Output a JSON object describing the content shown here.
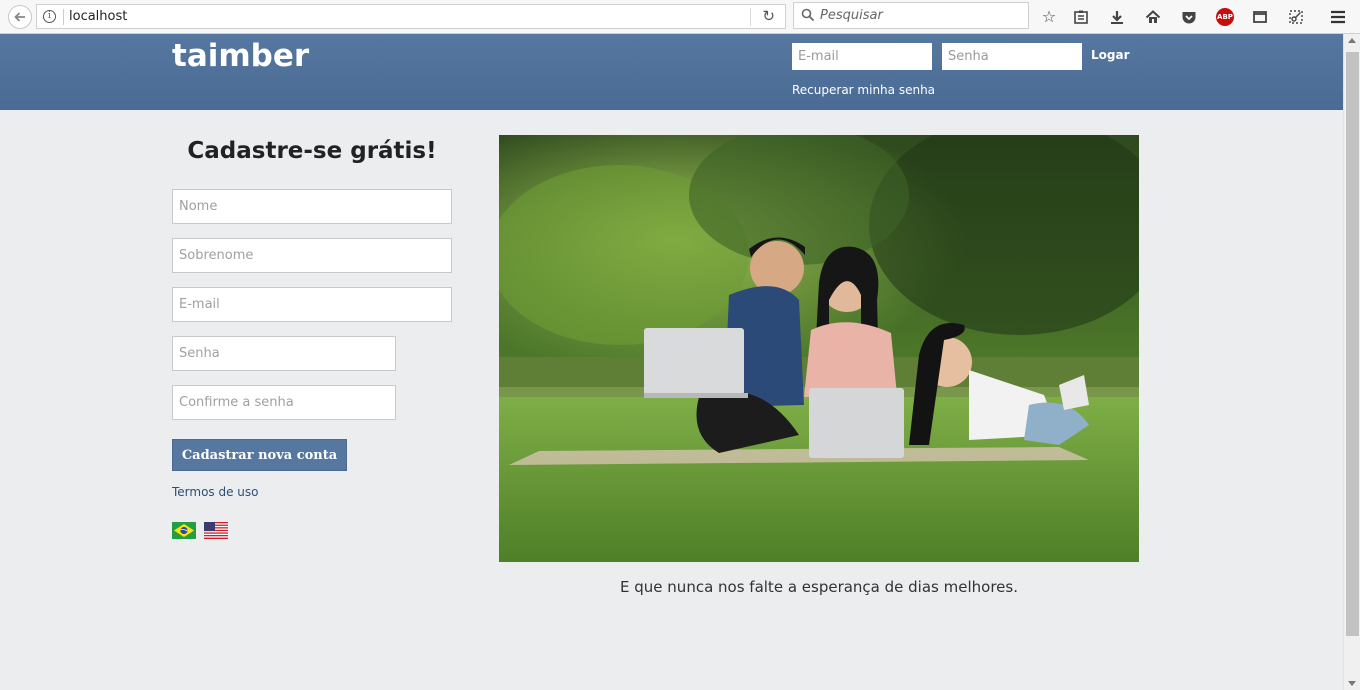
{
  "browser": {
    "url": "localhost",
    "search_placeholder": "Pesquisar",
    "abp_label": "ABP"
  },
  "header": {
    "logo": "taimber",
    "email_placeholder": "E-mail",
    "password_placeholder": "Senha",
    "login_label": "Logar",
    "recover_label": "Recuperar minha senha"
  },
  "signup": {
    "title": "Cadastre-se grátis!",
    "first_name_placeholder": "Nome",
    "last_name_placeholder": "Sobrenome",
    "email_placeholder": "E-mail",
    "password_placeholder": "Senha",
    "confirm_placeholder": "Confirme a senha",
    "submit_label": "Cadastrar nova conta",
    "terms_label": "Termos de uso"
  },
  "languages": [
    "pt-BR",
    "en-US"
  ],
  "hero": {
    "caption": "E que nunca nos falte a esperança de dias melhores."
  },
  "colors": {
    "header": "#4f709a",
    "button": "#5577a0",
    "page_bg": "#ebedef"
  }
}
